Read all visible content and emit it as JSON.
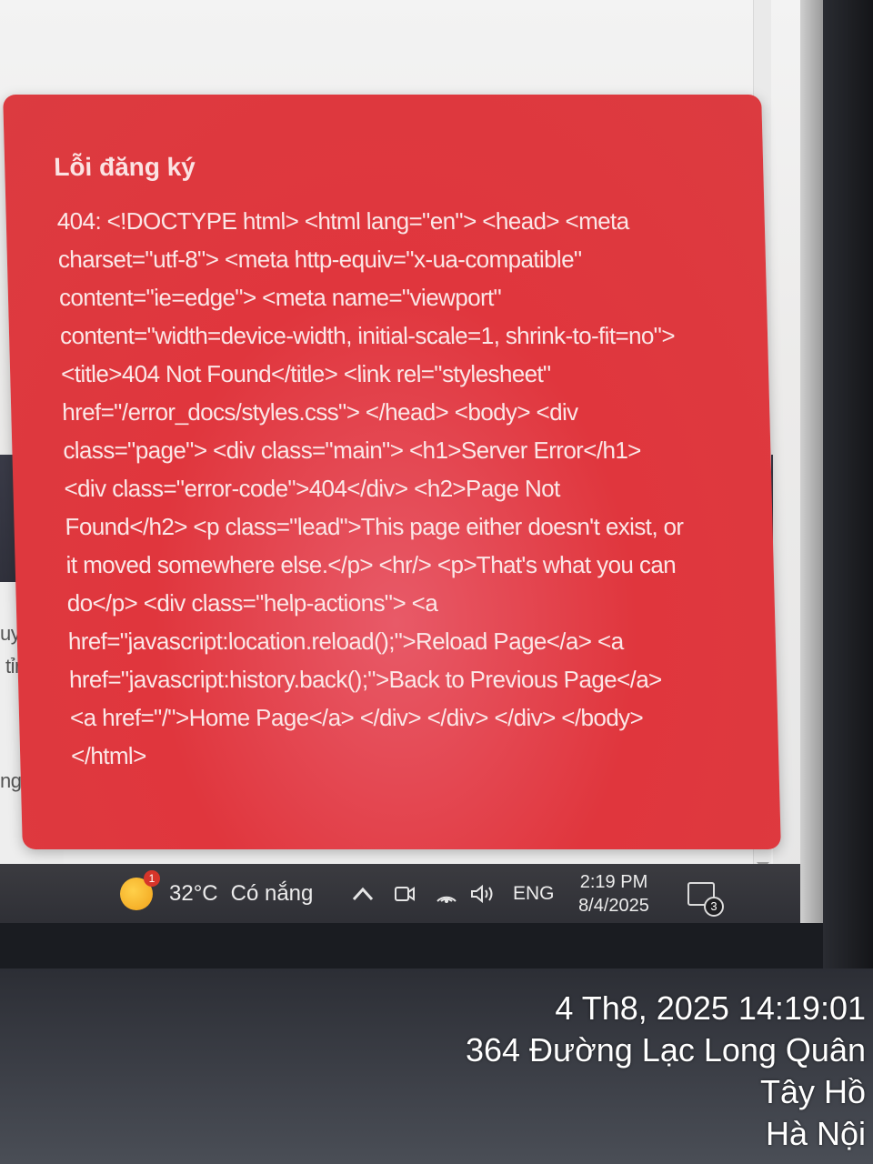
{
  "toast": {
    "title": "Lỗi đăng ký",
    "message": "404: <!DOCTYPE html> <html lang=\"en\"> <head> <meta charset=\"utf-8\"> <meta http-equiv=\"x-ua-compatible\" content=\"ie=edge\"> <meta name=\"viewport\" content=\"width=device-width, initial-scale=1, shrink-to-fit=no\"> <title>404 Not Found</title> <link rel=\"stylesheet\" href=\"/error_docs/styles.css\"> </head> <body> <div class=\"page\"> <div class=\"main\"> <h1>Server Error</h1> <div class=\"error-code\">404</div> <h2>Page Not Found</h2> <p class=\"lead\">This page either doesn't exist, or it moved somewhere else.</p> <hr/> <p>That's what you can do</p> <div class=\"help-actions\"> <a href=\"javascript:location.reload();\">Reload Page</a> <a href=\"javascript:history.back();\">Back to Previous Page</a> <a href=\"/\">Home Page</a> </div> </div> </div> </body> </html>",
    "color": "#e0363d"
  },
  "background_snippets": [
    "uyên",
    "tỉnh",
    "nguye"
  ],
  "taskbar": {
    "weather_badge": "1",
    "temperature": "32°C",
    "weather_text": "Có nắng",
    "language": "ENG",
    "time": "2:19 PM",
    "date": "8/4/2025",
    "notification_count": "3",
    "icons": [
      "weather-icon",
      "chevron-up-icon",
      "meet-now-icon",
      "wifi-icon",
      "volume-icon",
      "notification-icon"
    ]
  },
  "photo_stamp": {
    "datetime": "4 Th8, 2025 14:19:01",
    "address": "364 Đường Lạc Long Quân",
    "district": "Tây Hồ",
    "city": "Hà Nội"
  }
}
